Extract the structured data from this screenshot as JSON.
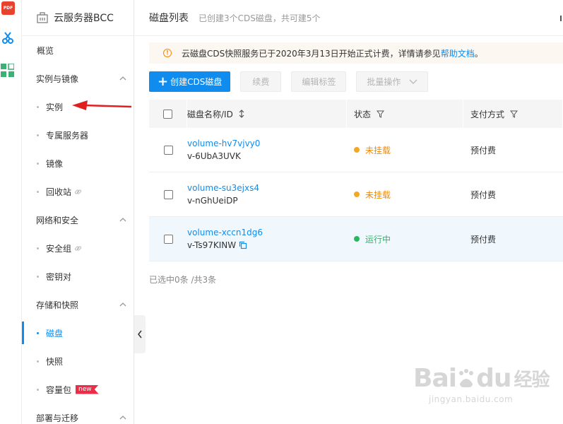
{
  "sidebar": {
    "title": "云服务器BCC",
    "overview": "概览",
    "groups": [
      {
        "label": "实例与镜像",
        "items": [
          "实例",
          "专属服务器",
          "镜像",
          "回收站"
        ]
      },
      {
        "label": "网络和安全",
        "items": [
          "安全组",
          "密钥对"
        ]
      },
      {
        "label": "存储和快照",
        "items": [
          "磁盘",
          "快照",
          "容量包"
        ]
      },
      {
        "label": "部署与迁移",
        "items": []
      }
    ],
    "new_badge": "new",
    "active_item": "磁盘"
  },
  "header": {
    "title": "磁盘列表",
    "subtitle": "已创建3个CDS磁盘，共可建5个"
  },
  "notice": {
    "text": "云磁盘CDS快照服务已于2020年3月13日开始正式计费，详情请参见",
    "link": "帮助文档",
    "end": "。"
  },
  "toolbar": {
    "create_label": "创建CDS磁盘",
    "renew_label": "续费",
    "edit_tags_label": "编辑标签",
    "batch_label": "批量操作"
  },
  "table": {
    "columns": [
      "磁盘名称/ID",
      "状态",
      "支付方式"
    ],
    "rows": [
      {
        "name": "volume-hv7vjvy0",
        "id": "v-6UbA3UVK",
        "status": "未挂载",
        "payment": "预付费"
      },
      {
        "name": "volume-su3ejxs4",
        "id": "v-nGhUeiDP",
        "status": "未挂载",
        "payment": "预付费"
      },
      {
        "name": "volume-xccn1dg6",
        "id": "v-Ts97KINW",
        "status": "运行中",
        "payment": "预付费"
      }
    ]
  },
  "summary": "已选中0条 /共3条",
  "watermark": {
    "brand": "Bai",
    "brand2": "du",
    "brand3": "经验",
    "url": "jingyan.baidu.com"
  },
  "colors": {
    "accent": "#108cee",
    "warning": "#f38900",
    "running": "#2cb663",
    "arrow": "#e02020"
  },
  "icons": {
    "pdf": "pdf-icon",
    "left_strip_2": "scissors-icon",
    "left_strip_3": "grid-icon"
  }
}
